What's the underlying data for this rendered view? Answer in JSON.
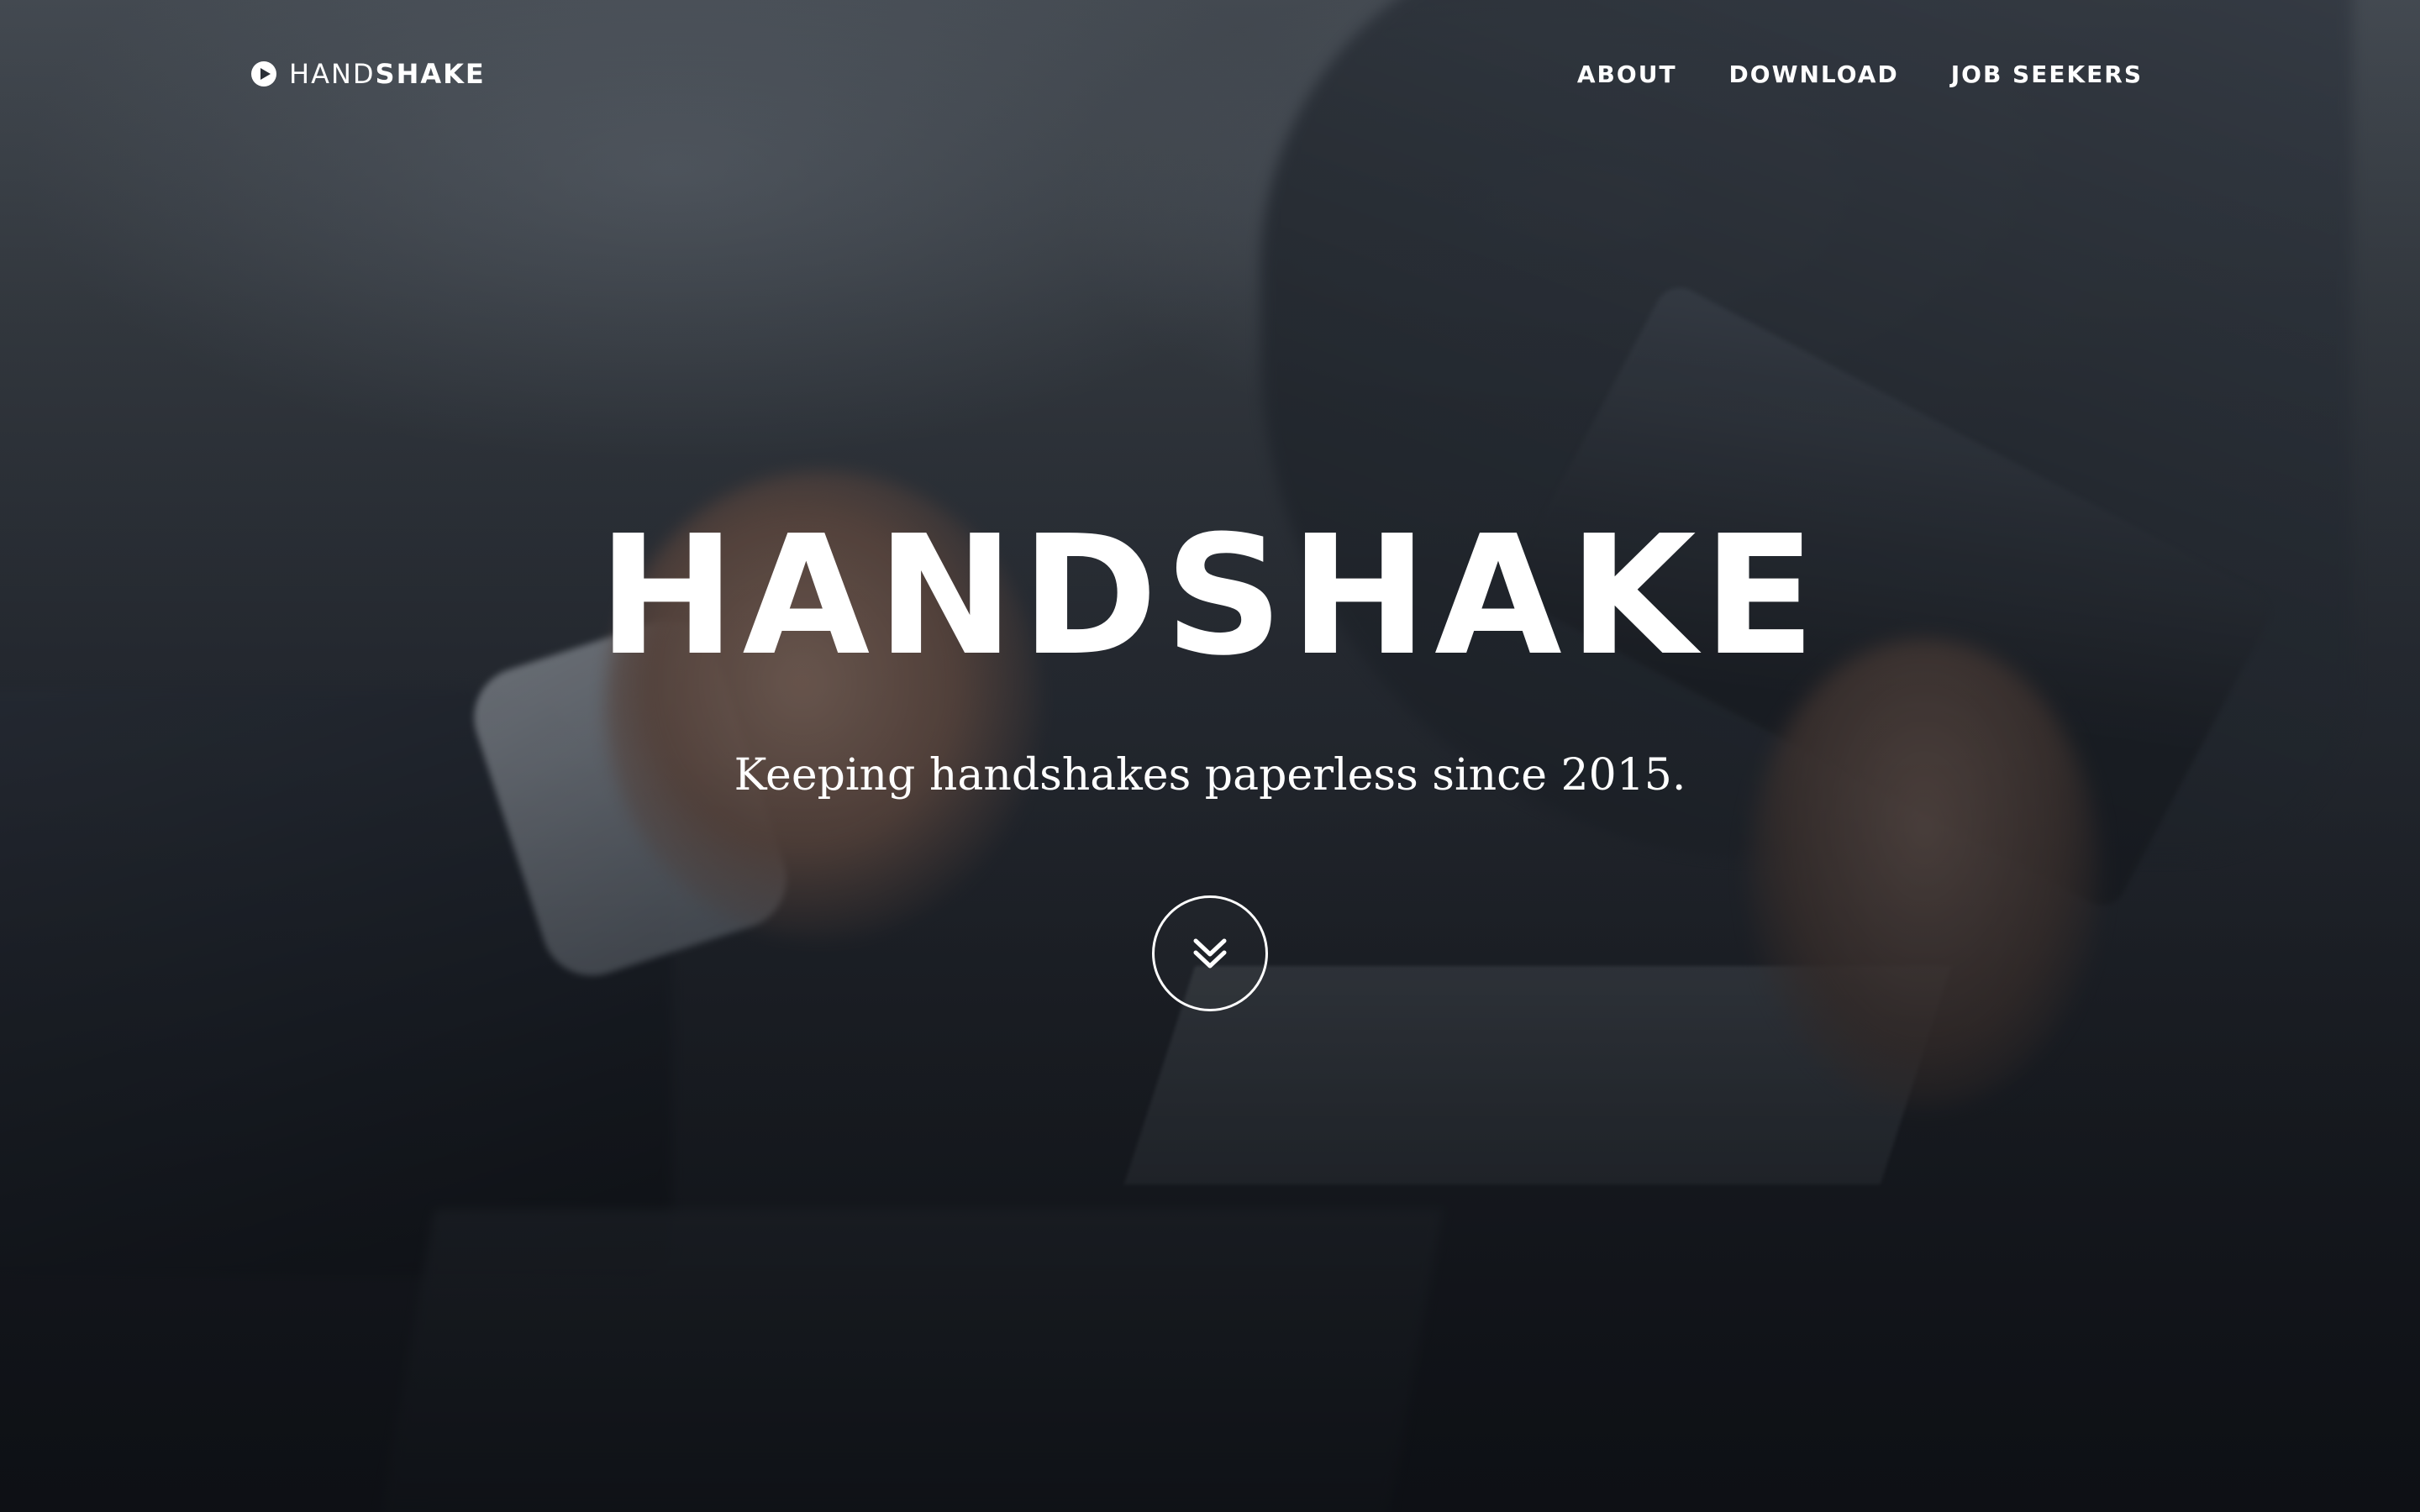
{
  "brand": {
    "name_light": "HAND",
    "name_bold": "SHAKE",
    "icon": "play-circle-icon"
  },
  "nav": {
    "items": [
      {
        "label": "ABOUT"
      },
      {
        "label": "DOWNLOAD"
      },
      {
        "label": "JOB SEEKERS"
      }
    ]
  },
  "hero": {
    "title": "HANDSHAKE",
    "subtitle": "Keeping handshakes paperless since 2015.",
    "scroll_icon": "double-chevron-down-icon"
  },
  "colors": {
    "text": "#ffffff",
    "overlay": "#1b1f26"
  }
}
